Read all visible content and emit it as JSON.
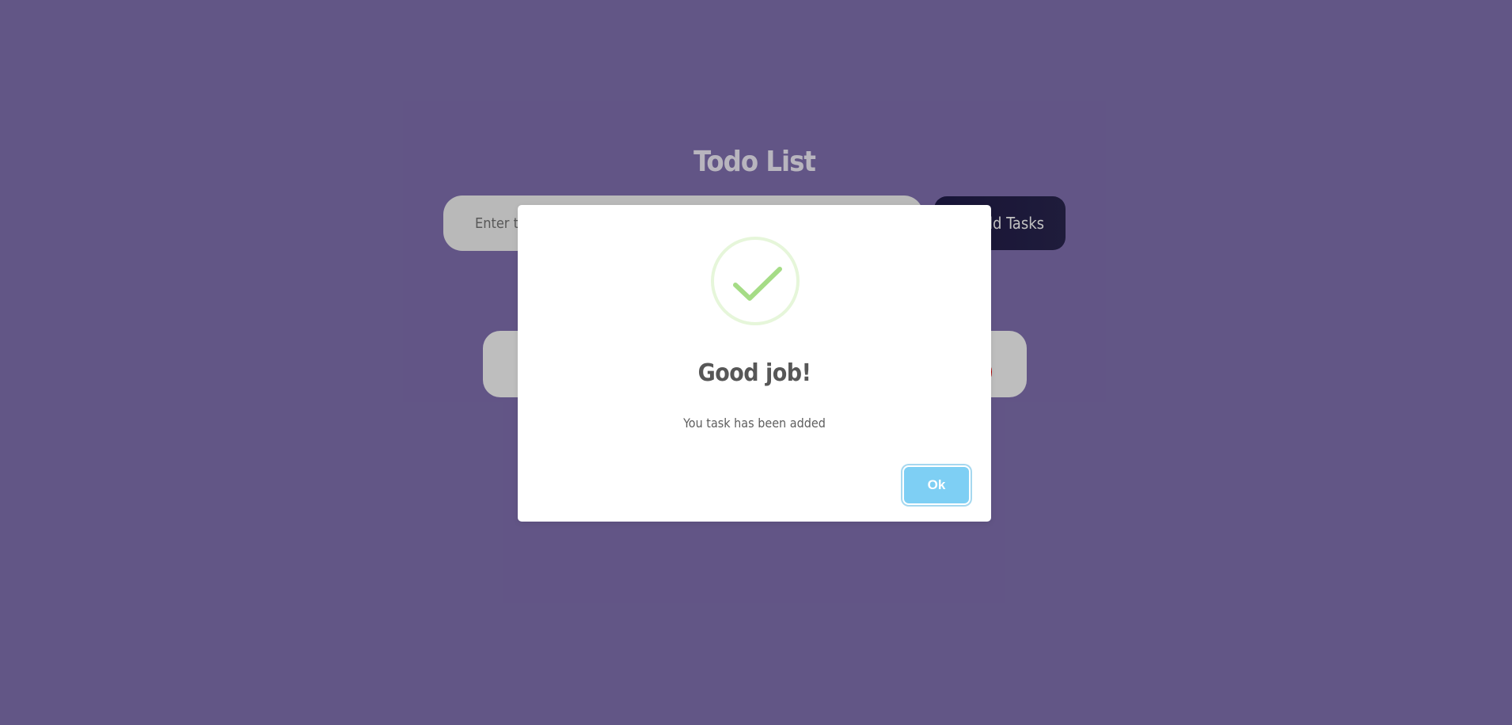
{
  "app": {
    "title": "Todo List",
    "input": {
      "placeholder": "Enter task",
      "value": ""
    },
    "add_button_label": "Add Tasks",
    "task_list": [
      {
        "delete_color": "#d40000"
      }
    ]
  },
  "modal": {
    "icon": "check-icon",
    "title": "Good job!",
    "message": "You task has been added",
    "confirm_label": "Ok",
    "confirm_color": "#7ecff4"
  },
  "colors": {
    "background": "#645689",
    "success": "#a5dc86"
  }
}
